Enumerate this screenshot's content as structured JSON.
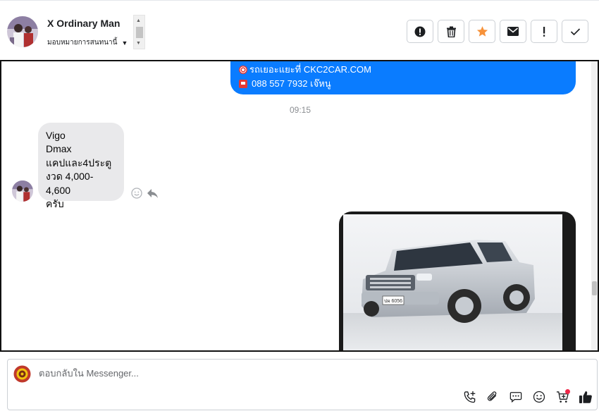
{
  "header": {
    "contact_name": "X Ordinary Man",
    "assign_label": "มอบหมายการสนทนานี้"
  },
  "actions": [
    {
      "name": "report-button",
      "icon": "alert-circle-icon"
    },
    {
      "name": "delete-button",
      "icon": "trash-icon"
    },
    {
      "name": "star-button",
      "icon": "star-icon",
      "color": "#f7923a"
    },
    {
      "name": "mark-unread-button",
      "icon": "envelope-icon"
    },
    {
      "name": "important-button",
      "icon": "exclamation-icon"
    },
    {
      "name": "done-button",
      "icon": "check-icon"
    }
  ],
  "conversation": {
    "outgoing_text": {
      "line1": "รถเยอะแยะที่ CKC2CAR.COM",
      "line2": "088 557 7932 เจ๊หนู"
    },
    "timestamp": "09:15",
    "incoming_lines": [
      "Vigo",
      "Dmax",
      "แคปและ4ประตู",
      "งวด 4,000-4,600",
      "ครับ"
    ],
    "outgoing_bubble_color": "#0a7cff",
    "incoming_bubble_color": "#e9e9eb"
  },
  "composer": {
    "placeholder": "ตอบกลับใน Messenger..."
  }
}
